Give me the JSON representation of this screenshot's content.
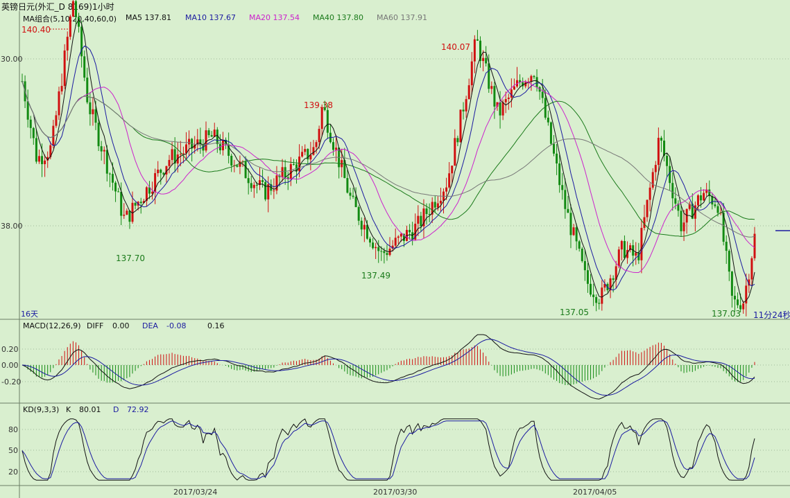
{
  "window": {
    "title": "英镑日元(外汇_D 8169)1小时"
  },
  "main_panel": {
    "legend": [
      {
        "label": "MA组合(5,10,20,40,60,0)",
        "color": "#111111"
      },
      {
        "label": "MA5 137.81",
        "color": "#111111"
      },
      {
        "label": "MA10 137.67",
        "color": "#1a1aa0"
      },
      {
        "label": "MA20 137.54",
        "color": "#cc22cc"
      },
      {
        "label": "MA40 137.80",
        "color": "#1a7a1a"
      },
      {
        "label": "MA60 137.91",
        "color": "#777777"
      }
    ],
    "y_ticks": [
      {
        "label": "30.00",
        "value": 139.5
      },
      {
        "label": "38.00",
        "value": 138.0
      }
    ],
    "peak_labels": [
      {
        "text": "140.40",
        "color": "#d01010",
        "value": 140.4
      },
      {
        "text": "137.70",
        "color": "#1a7a1a",
        "value": 137.7
      },
      {
        "text": "139.38",
        "color": "#d01010",
        "value": 139.38
      },
      {
        "text": "137.49",
        "color": "#1a7a1a",
        "value": 137.49
      },
      {
        "text": "140.07",
        "color": "#d01010",
        "value": 140.07
      },
      {
        "text": "137.05",
        "color": "#1a7a1a",
        "value": 137.05
      },
      {
        "text": "137.03",
        "color": "#1a7a1a",
        "value": 137.03
      }
    ],
    "span_label": "16天",
    "countdown": "11分24秒"
  },
  "macd_panel": {
    "legend_name": "MACD(12,26,9)",
    "diff_label": "DIFF",
    "diff_value": "0.00",
    "dea_label": "DEA",
    "dea_value": "-0.08",
    "macd_value": "0.16",
    "y_ticks": [
      "0.20",
      "0.00",
      "-0.20"
    ]
  },
  "kd_panel": {
    "legend_name": "KD(9,3,3)",
    "k_label": "K",
    "k_value": "80.01",
    "d_label": "D",
    "d_value": "72.92",
    "y_ticks": [
      "80",
      "50",
      "20"
    ]
  },
  "x_axis": {
    "ticks": [
      "2017/03/24",
      "2017/03/30",
      "2017/04/05"
    ]
  },
  "colors": {
    "background": "#d9efcf",
    "up": "#d01010",
    "down": "#128a12",
    "grid": "#9fb89a"
  },
  "chart_data": {
    "type": "line",
    "title": "英镑日元(外汇_D 8169)1小时",
    "x_key_points": [
      "2017/03/24",
      "2017/03/30",
      "2017/04/05"
    ],
    "price_key_points": [
      {
        "label": "high",
        "value": 140.4
      },
      {
        "label": "low",
        "value": 137.7
      },
      {
        "label": "high",
        "value": 139.38
      },
      {
        "label": "low",
        "value": 137.49
      },
      {
        "label": "high",
        "value": 140.07
      },
      {
        "label": "low",
        "value": 137.05
      },
      {
        "label": "low",
        "value": 137.03
      }
    ],
    "ma_latest": {
      "MA5": 137.81,
      "MA10": 137.67,
      "MA20": 137.54,
      "MA40": 137.8,
      "MA60": 137.91
    },
    "macd_latest": {
      "DIFF": 0.0,
      "DEA": -0.08,
      "MACD": 0.16
    },
    "kd_latest": {
      "K": 80.01,
      "D": 72.92
    }
  }
}
